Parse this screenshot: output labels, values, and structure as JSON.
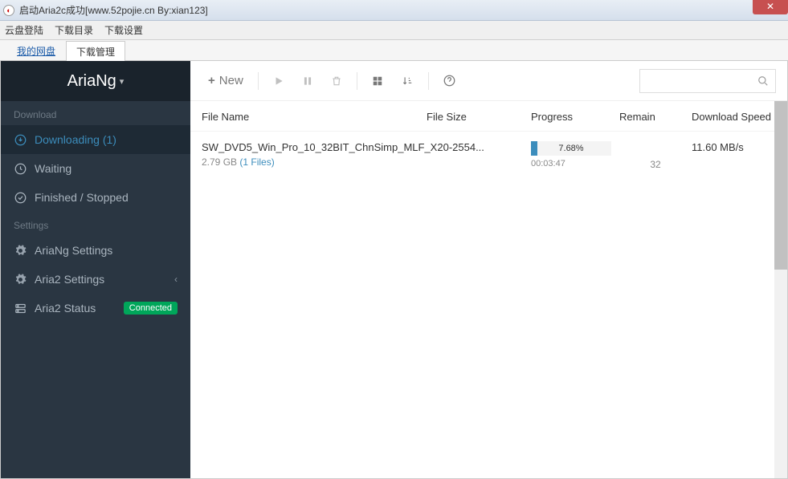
{
  "window": {
    "title": "启动Aria2c成功[www.52pojie.cn By:xian123]",
    "close": "✕"
  },
  "menu": {
    "items": [
      "云盘登陆",
      "下载目录",
      "下载设置"
    ]
  },
  "tabs": {
    "items": [
      "我的网盘",
      "下载管理"
    ],
    "active_index": 1
  },
  "sidebar": {
    "brand": "AriaNg",
    "sections": {
      "download": {
        "label": "Download",
        "items": [
          {
            "label": "Downloading (1)"
          },
          {
            "label": "Waiting"
          },
          {
            "label": "Finished / Stopped"
          }
        ]
      },
      "settings": {
        "label": "Settings",
        "items": [
          {
            "label": "AriaNg Settings"
          },
          {
            "label": "Aria2 Settings"
          },
          {
            "label": "Aria2 Status",
            "badge": "Connected"
          }
        ]
      }
    }
  },
  "toolbar": {
    "new_label": "New"
  },
  "table": {
    "headers": {
      "name": "File Name",
      "size": "File Size",
      "progress": "Progress",
      "remain": "Remain",
      "speed": "Download Speed"
    },
    "rows": [
      {
        "name": "SW_DVD5_Win_Pro_10_32BIT_ChnSimp_MLF_X20-2554...",
        "size": "2.79 GB",
        "files": "(1 Files)",
        "percent_text": "7.68%",
        "percent": 7.68,
        "eta": "00:03:47",
        "remain": "32",
        "speed": "11.60 MB/s"
      }
    ]
  }
}
